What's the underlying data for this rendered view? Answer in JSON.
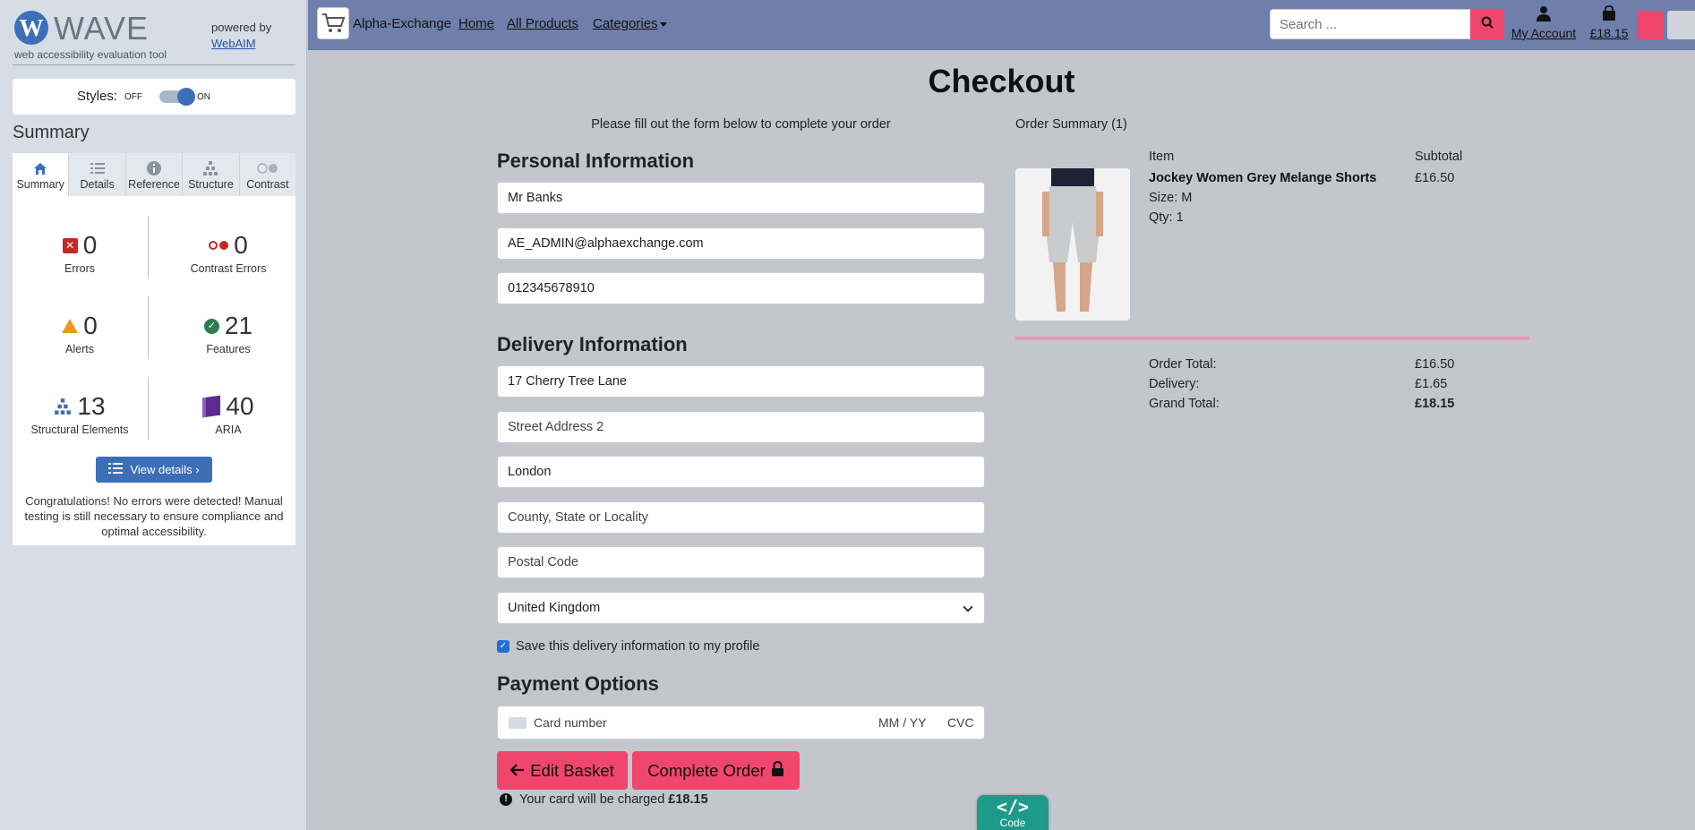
{
  "wave": {
    "logo_letter": "W",
    "logo_text": "WAVE",
    "tagline": "web accessibility evaluation tool",
    "powered_by": "powered by",
    "powered_link": "WebAIM",
    "styles_label": "Styles:",
    "styles_off": "OFF",
    "styles_on": "ON",
    "summary_title": "Summary",
    "tabs": [
      {
        "label": "Summary",
        "icon": "home-icon"
      },
      {
        "label": "Details",
        "icon": "list-icon"
      },
      {
        "label": "Reference",
        "icon": "info-icon"
      },
      {
        "label": "Structure",
        "icon": "structure-icon"
      },
      {
        "label": "Contrast",
        "icon": "contrast-icon"
      }
    ],
    "stats": {
      "errors": {
        "value": "0",
        "label": "Errors"
      },
      "contrast_errors": {
        "value": "0",
        "label": "Contrast Errors"
      },
      "alerts": {
        "value": "0",
        "label": "Alerts"
      },
      "features": {
        "value": "21",
        "label": "Features"
      },
      "structural": {
        "value": "13",
        "label": "Structural Elements"
      },
      "aria": {
        "value": "40",
        "label": "ARIA"
      }
    },
    "view_details": "View details ›",
    "congrats": "Congratulations! No errors were detected! Manual testing is still necessary to ensure compliance and optimal accessibility."
  },
  "nav": {
    "brand": "Alpha-Exchange",
    "home": "Home",
    "all_products": "All Products",
    "categories": "Categories",
    "search_placeholder": "Search ...",
    "account": "My Account",
    "cart_total": "£18.15"
  },
  "checkout": {
    "title": "Checkout",
    "intro": "Please fill out the form below to complete your order",
    "personal_heading": "Personal Information",
    "full_name": "Mr Banks",
    "email": "AE_ADMIN@alphaexchange.com",
    "phone": "012345678910",
    "delivery_heading": "Delivery Information",
    "street1": "17 Cherry Tree Lane",
    "street2_placeholder": "Street Address 2",
    "town": "London",
    "county_placeholder": "County, State or Locality",
    "postcode_placeholder": "Postal Code",
    "country": "United Kingdom",
    "save_info": "Save this delivery information to my profile",
    "payment_heading": "Payment Options",
    "card_number_placeholder": "Card number",
    "card_expiry_placeholder": "MM / YY",
    "card_cvc_placeholder": "CVC",
    "edit_basket": "Edit Basket",
    "complete_order": "Complete Order",
    "charge_text": "Your card will be charged",
    "charge_amount": "£18.15"
  },
  "order_summary": {
    "title": "Order Summary (1)",
    "col_item": "Item",
    "col_subtotal": "Subtotal",
    "item": {
      "name": "Jockey Women Grey Melange Shorts",
      "size": "Size: M",
      "qty": "Qty: 1",
      "subtotal": "£16.50"
    },
    "order_total_label": "Order Total:",
    "order_total": "£16.50",
    "delivery_label": "Delivery:",
    "delivery": "£1.65",
    "grand_total_label": "Grand Total:",
    "grand_total": "£18.15"
  },
  "code_tab": {
    "symbol": "</>",
    "label": "Code"
  },
  "colors": {
    "accent": "#f0466e",
    "nav_bg": "#6f7fab",
    "wave_blue": "#3c6fb7"
  }
}
